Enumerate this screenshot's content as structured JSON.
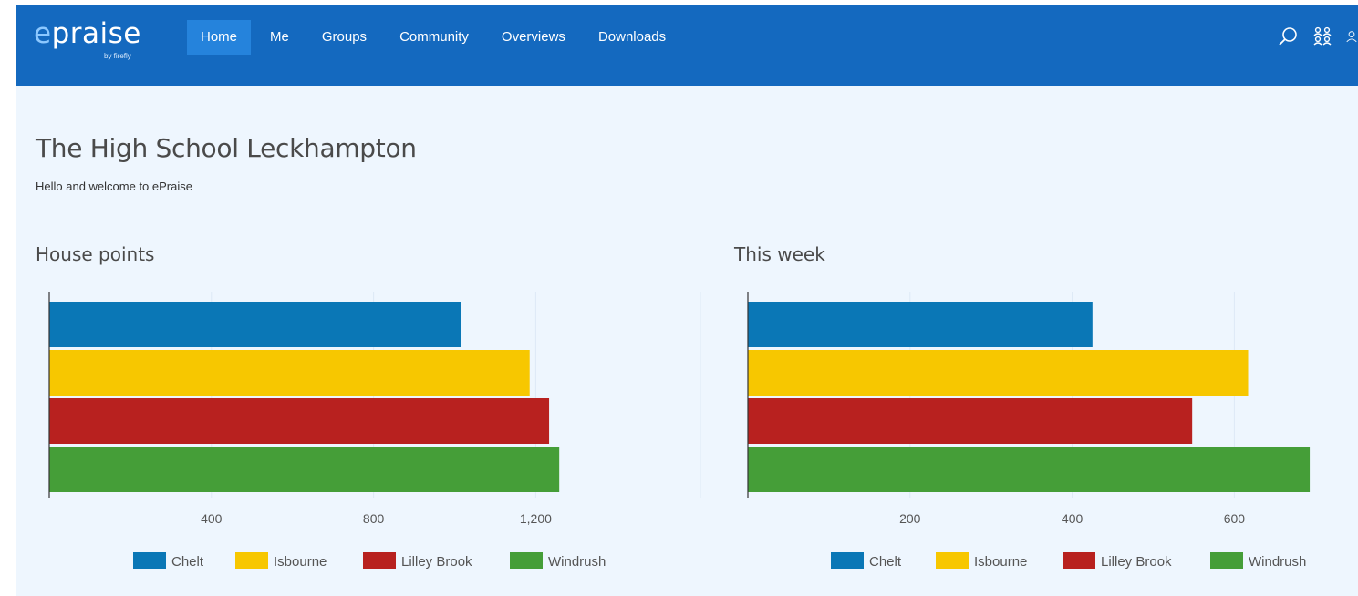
{
  "logo": {
    "e": "e",
    "rest": "praise",
    "sub": "by firefly"
  },
  "nav": {
    "items": [
      {
        "label": "Home",
        "active": true
      },
      {
        "label": "Me"
      },
      {
        "label": "Groups"
      },
      {
        "label": "Community"
      },
      {
        "label": "Overviews"
      },
      {
        "label": "Downloads"
      }
    ],
    "icons": [
      "search-icon",
      "groups-icon",
      "user-icon"
    ]
  },
  "page": {
    "title": "The High School Leckhampton",
    "welcome": "Hello and welcome to ePraise"
  },
  "colors": {
    "nav_bg": "#1469bf",
    "active_tab": "#2583dc",
    "Chelt": "#0a77b6",
    "Isbourne": "#f7c700",
    "Lilley Brook": "#b8211f",
    "Windrush": "#459e38"
  },
  "chart_data": [
    {
      "type": "bar",
      "orientation": "horizontal",
      "title": "House points",
      "categories": [
        "Chelt",
        "Isbourne",
        "Lilley Brook",
        "Windrush"
      ],
      "values": [
        1015,
        1185,
        1233,
        1258
      ],
      "xticks": [
        400,
        800,
        1200
      ],
      "xtick_labels": [
        "400",
        "800",
        "1,200"
      ],
      "xlim": [
        0,
        1600
      ],
      "legend": [
        "Chelt",
        "Isbourne",
        "Lilley Brook",
        "Windrush"
      ],
      "legend_position": "bottom",
      "grid": true
    },
    {
      "type": "bar",
      "orientation": "horizontal",
      "title": "This week",
      "categories": [
        "Chelt",
        "Isbourne",
        "Lilley Brook",
        "Windrush"
      ],
      "values": [
        425,
        617,
        548,
        693
      ],
      "xticks": [
        200,
        400,
        600
      ],
      "xtick_labels": [
        "200",
        "400",
        "600"
      ],
      "xlim": [
        0,
        800
      ],
      "legend": [
        "Chelt",
        "Isbourne",
        "Lilley Brook",
        "Windrush"
      ],
      "legend_position": "bottom",
      "grid": true
    }
  ]
}
